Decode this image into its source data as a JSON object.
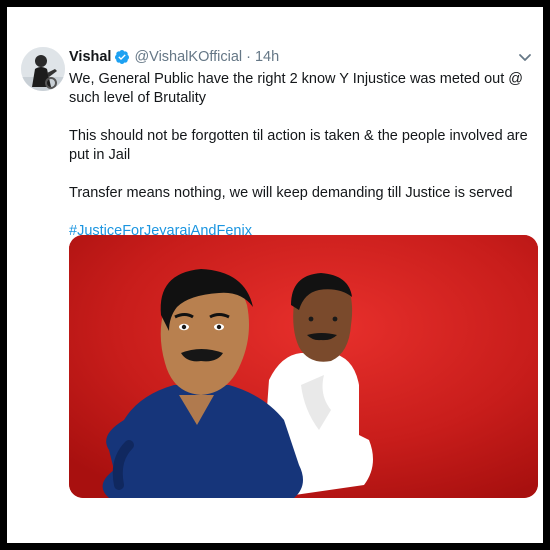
{
  "tweet": {
    "author_name": "Vishal",
    "handle": "@VishalKOfficial",
    "separator": "·",
    "time": "14h",
    "paragraphs": [
      "We, General Public have the right 2 know Y Injustice was meted out @ such level of Brutality",
      "This should not be forgotten til action is taken & the people involved are put in Jail",
      "Transfer means nothing, we will keep demanding till Justice is served"
    ],
    "hashtag": "#JusticeForJeyarajAndFenix",
    "icons": {
      "verified": "verified-badge-icon",
      "more": "chevron-down-icon"
    },
    "colors": {
      "link": "#1b95e0",
      "verified": "#1da1f2",
      "secondary_text": "#657786",
      "media_background": "#c71c1a"
    }
  }
}
